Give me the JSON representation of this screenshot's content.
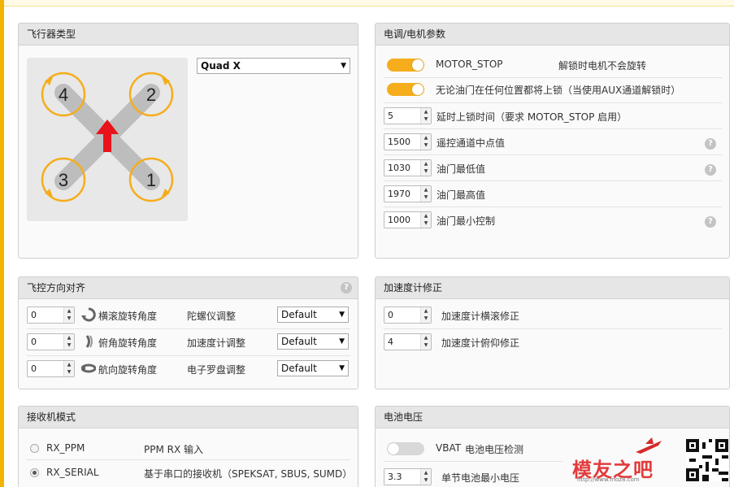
{
  "frame_type": {
    "title": "飞行器类型",
    "selected": "Quad X",
    "motors": [
      "4",
      "2",
      "3",
      "1"
    ]
  },
  "esc": {
    "title": "电调/电机参数",
    "motor_stop_label": "MOTOR_STOP",
    "motor_stop_desc": "解锁时电机不会旋转",
    "arm_any_label": "无论油门在任何位置都将上锁（当使用AUX通道解锁时）",
    "rows": [
      {
        "value": "5",
        "label": "延时上锁时间（要求 MOTOR_STOP 启用）",
        "help": false
      },
      {
        "value": "1500",
        "label": "遥控通道中点值",
        "help": true
      },
      {
        "value": "1030",
        "label": "油门最低值",
        "help": true
      },
      {
        "value": "1970",
        "label": "油门最高值",
        "help": false
      },
      {
        "value": "1000",
        "label": "油门最小控制",
        "help": true
      }
    ],
    "help_glyph": "?"
  },
  "alignment": {
    "title": "飞控方向对齐",
    "help_glyph": "?",
    "rows": [
      {
        "value": "0",
        "label": "横滚旋转角度",
        "sensor": "陀螺仪调整",
        "select": "Default"
      },
      {
        "value": "0",
        "label": "俯角旋转角度",
        "sensor": "加速度计调整",
        "select": "Default"
      },
      {
        "value": "0",
        "label": "航向旋转角度",
        "sensor": "电子罗盘调整",
        "select": "Default"
      }
    ]
  },
  "accel": {
    "title": "加速度计修正",
    "rows": [
      {
        "value": "0",
        "label": "加速度计横滚修正"
      },
      {
        "value": "4",
        "label": "加速度计俯仰修正"
      }
    ]
  },
  "receiver": {
    "title": "接收机模式",
    "rows": [
      {
        "name": "RX_PPM",
        "desc": "PPM RX 输入",
        "checked": false
      },
      {
        "name": "RX_SERIAL",
        "desc": "基于串口的接收机（SPEKSAT, SBUS, SUMD）",
        "checked": true
      }
    ]
  },
  "battery": {
    "title": "电池电压",
    "vbat_label": "VBAT",
    "vbat_desc": "电池电压检测",
    "min_cell_value": "3.3",
    "min_cell_label": "单节电池最小电压"
  },
  "watermark": {
    "brand": "模友之吧",
    "url": "http://www.moz8.com"
  },
  "colors": {
    "accent": "#f5ad1c",
    "arrow": "#e8131a"
  }
}
